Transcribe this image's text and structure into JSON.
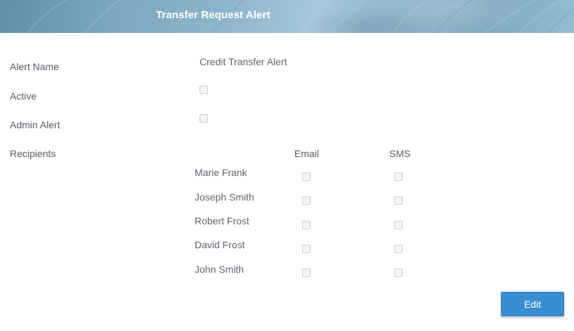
{
  "header": {
    "title": "Transfer Request Alert"
  },
  "form": {
    "alert_name_label": "Alert Name",
    "alert_name_value": "Credit Transfer Alert",
    "active_label": "Active",
    "admin_alert_label": "Admin Alert",
    "recipients_label": "Recipients",
    "email_header": "Email",
    "sms_header": "SMS",
    "recipients": [
      {
        "name": "Marie Frank",
        "email": false,
        "sms": false
      },
      {
        "name": "Joseph Smith",
        "email": false,
        "sms": false
      },
      {
        "name": "Robert Frost",
        "email": false,
        "sms": false
      },
      {
        "name": "David Frost",
        "email": false,
        "sms": false
      },
      {
        "name": "John Smith",
        "email": false,
        "sms": false
      }
    ],
    "active_checked": false,
    "admin_alert_checked": false
  },
  "actions": {
    "edit_label": "Edit"
  },
  "colors": {
    "accent": "#3a8ed0",
    "header_text": "#ffffff",
    "label_text": "#555b62"
  }
}
